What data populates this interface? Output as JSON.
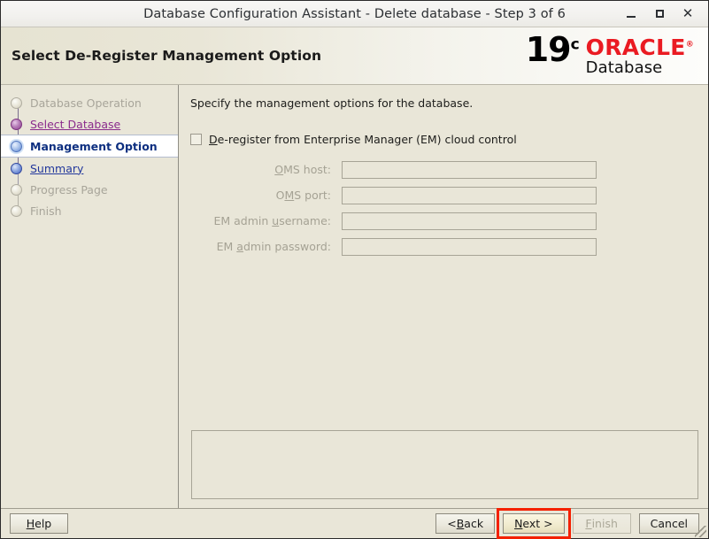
{
  "window": {
    "title": "Database Configuration Assistant - Delete database - Step 3 of 6",
    "controls": {
      "minimize": "minimize-icon",
      "maximize": "maximize-icon",
      "close": "close-icon"
    }
  },
  "header": {
    "title": "Select De-Register Management Option",
    "logo": {
      "version": "19",
      "version_sup": "c",
      "brand": "ORACLE",
      "brand_sup": "®",
      "product": "Database",
      "brand_color": "#ea1b22"
    }
  },
  "sidebar": {
    "items": [
      {
        "label": "Database Operation",
        "state": "pending"
      },
      {
        "label": "Select Database",
        "state": "visited"
      },
      {
        "label": "Management Option",
        "state": "active"
      },
      {
        "label": "Summary",
        "state": "upcoming"
      },
      {
        "label": "Progress Page",
        "state": "pending"
      },
      {
        "label": "Finish",
        "state": "pending"
      }
    ]
  },
  "main": {
    "intro": "Specify the management options for the database.",
    "checkbox": {
      "mnemonic": "D",
      "label_rest": "e-register from Enterprise Manager (EM) cloud control",
      "checked": false
    },
    "fields": [
      {
        "label_pre": "",
        "mnemonic": "O",
        "label_post": "MS host:",
        "value": "",
        "placeholder": "",
        "enabled": false
      },
      {
        "label_pre": "O",
        "mnemonic": "M",
        "label_post": "S port:",
        "value": "",
        "placeholder": "",
        "enabled": false
      },
      {
        "label_pre": "EM admin ",
        "mnemonic": "u",
        "label_post": "sername:",
        "value": "",
        "placeholder": "",
        "enabled": false
      },
      {
        "label_pre": "EM ",
        "mnemonic": "a",
        "label_post": "dmin password:",
        "value": "",
        "placeholder": "",
        "enabled": false
      }
    ],
    "message_panel": ""
  },
  "footer": {
    "help": {
      "mnemonic": "H",
      "rest": "elp",
      "enabled": true
    },
    "back": {
      "pre": "< ",
      "mnemonic": "B",
      "rest": "ack",
      "enabled": true
    },
    "next": {
      "mnemonic": "N",
      "rest": "ext >",
      "enabled": true,
      "focused": true,
      "annotated": true
    },
    "finish": {
      "mnemonic": "F",
      "rest": "inish",
      "enabled": false
    },
    "cancel": {
      "pre": "Cancel",
      "enabled": true
    },
    "annotation_color": "#f42000"
  }
}
